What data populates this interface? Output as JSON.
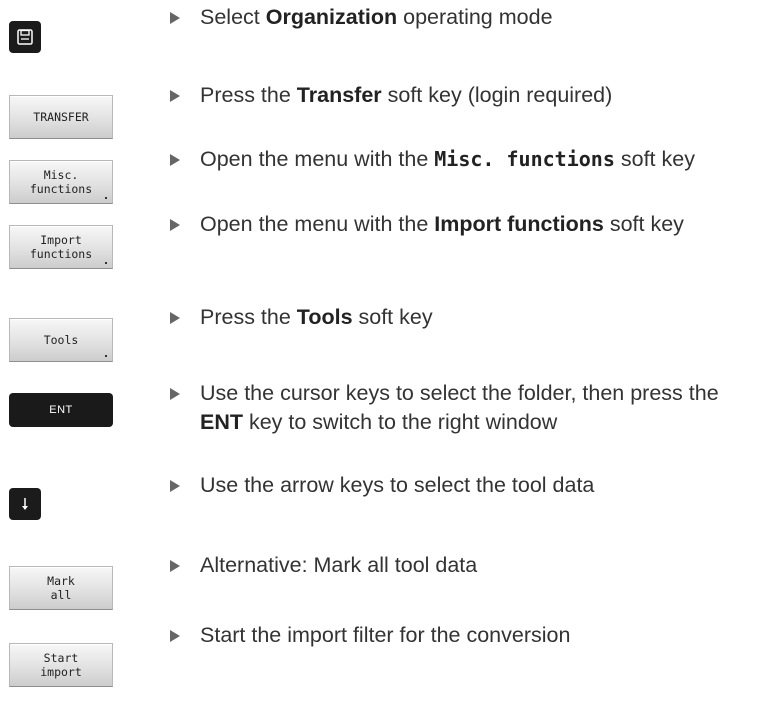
{
  "steps": [
    {
      "key_label": "",
      "key_icon": "floppy-disk-icon",
      "pre": "Select ",
      "bold": "Organization",
      "post": " operating mode"
    },
    {
      "key_label": "TRANSFER",
      "pre": "Press the ",
      "bold": "Transfer",
      "post": " soft key (login required)"
    },
    {
      "key_label": "Misc.\nfunctions",
      "pre": "Open the menu with the ",
      "bold": "Misc. functions",
      "post": " soft key"
    },
    {
      "key_label": "Import\nfunctions",
      "pre": "Open the menu with the ",
      "bold": "Import functions",
      "post": " soft key"
    },
    {
      "key_label": "Tools",
      "pre": "Press the ",
      "bold": "Tools",
      "post": " soft key"
    },
    {
      "key_label": "ENT",
      "pre": "Use the cursor keys to select the folder, then press the ",
      "bold": "ENT",
      "post": " key to switch to the right window"
    },
    {
      "key_label": "",
      "key_icon": "arrow-down-icon",
      "pre": "Use the arrow keys to select the tool data",
      "bold": "",
      "post": ""
    },
    {
      "key_label": "Mark\nall",
      "pre": "Alternative: Mark all tool data",
      "bold": "",
      "post": ""
    },
    {
      "key_label": "Start\nimport",
      "pre": "Start the import filter for the conversion",
      "bold": "",
      "post": ""
    }
  ]
}
